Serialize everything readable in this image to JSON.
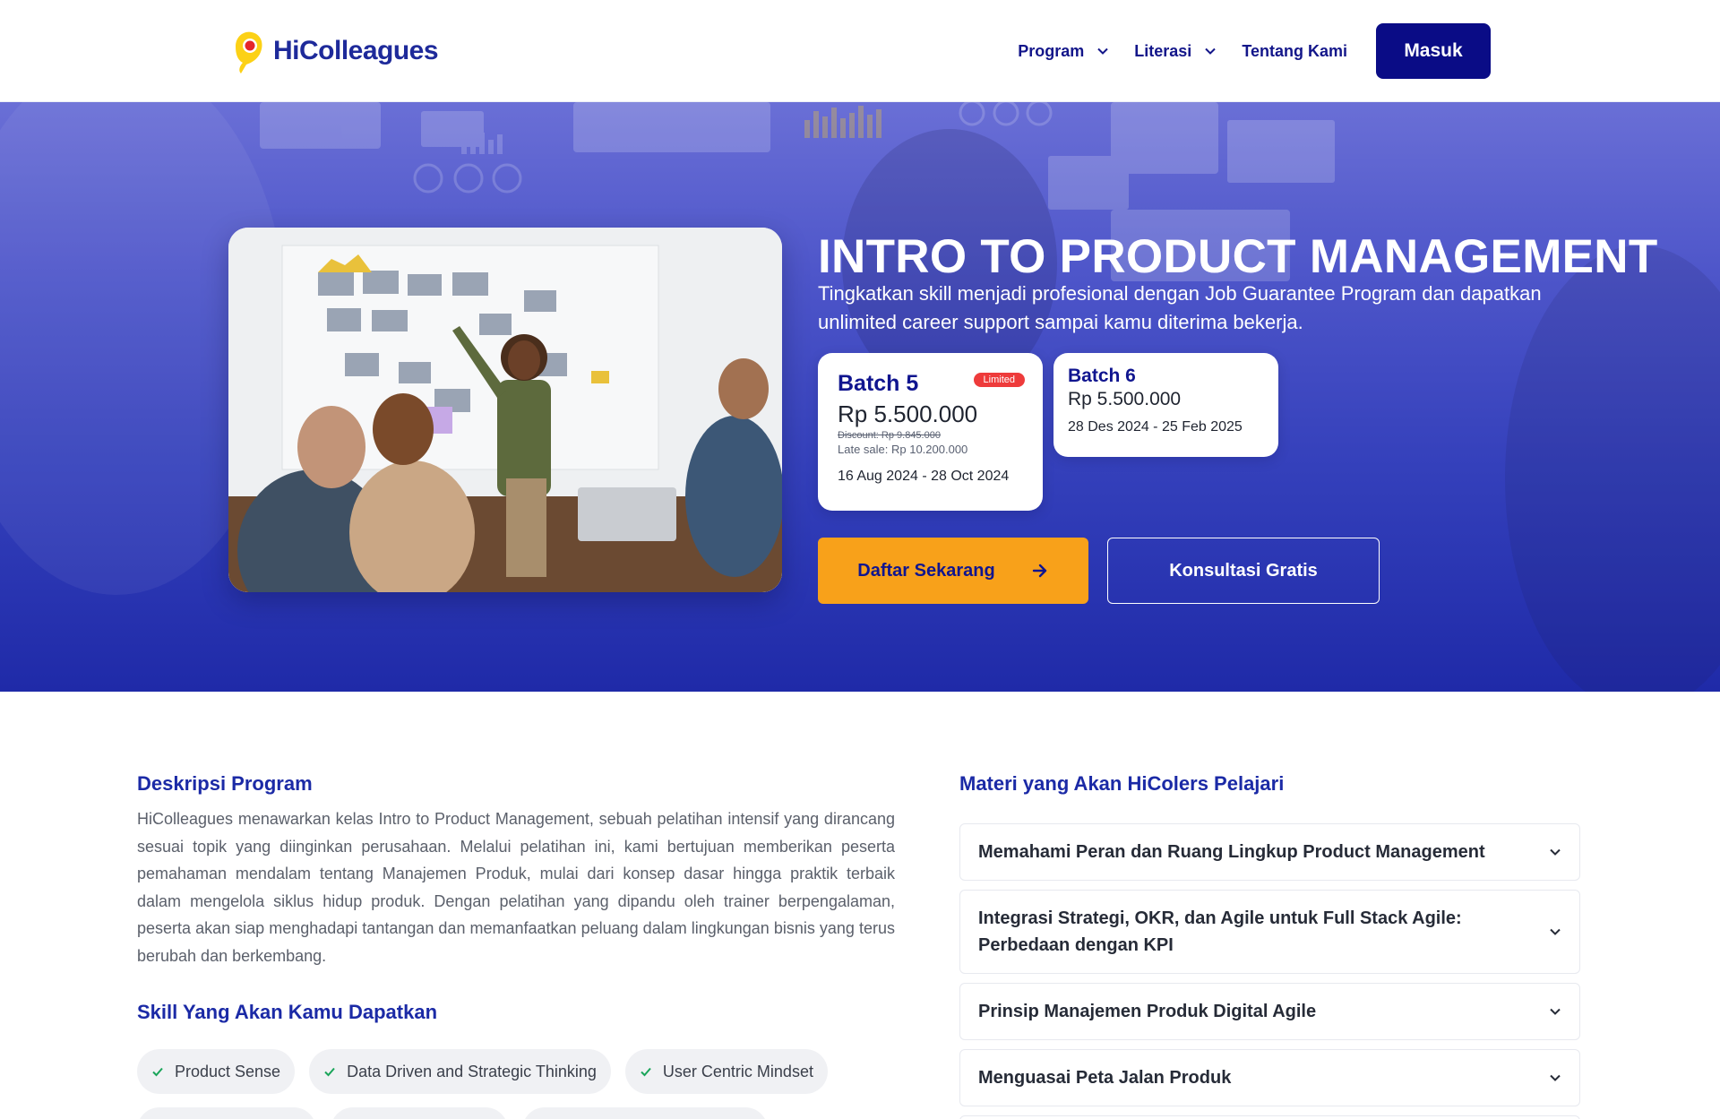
{
  "header": {
    "logo_text": "HiColleagues",
    "nav": [
      {
        "label": "Program",
        "has_dropdown": true
      },
      {
        "label": "Literasi",
        "has_dropdown": true
      },
      {
        "label": "Tentang Kami",
        "has_dropdown": false
      }
    ],
    "login_label": "Masuk"
  },
  "hero": {
    "title": "INTRO TO PRODUCT MANAGEMENT",
    "subtitle": "Tingkatkan skill menjadi profesional dengan Job Guarantee Program dan dapatkan unlimited career support sampai kamu diterima bekerja.",
    "batches": [
      {
        "name": "Batch 5",
        "badge": "Limited",
        "price": "Rp 5.500.000",
        "discount_note": "Discount: Rp 9.845.000",
        "late_sale": "Late sale: Rp 10.200.000",
        "dates": "16 Aug 2024 - 28 Oct 2024"
      },
      {
        "name": "Batch 6",
        "price": "Rp 5.500.000",
        "dates": "28 Des 2024 - 25 Feb 2025"
      }
    ],
    "cta_primary": "Daftar Sekarang",
    "cta_secondary": "Konsultasi Gratis"
  },
  "description": {
    "title": "Deskripsi Program",
    "text": "HiColleagues menawarkan kelas Intro to Product Management, sebuah pelatihan intensif yang dirancang sesuai topik yang diinginkan perusahaan. Melalui pelatihan ini, kami bertujuan memberikan peserta pemahaman mendalam tentang Manajemen Produk, mulai dari konsep dasar hingga praktik terbaik dalam mengelola siklus hidup produk. Dengan pelatihan yang dipandu oleh trainer berpengalaman, peserta akan siap menghadapi tantangan dan memanfaatkan peluang dalam lingkungan bisnis yang terus berubah dan berkembang."
  },
  "skills": {
    "title": "Skill Yang Akan Kamu Dapatkan",
    "items": [
      "Product Sense",
      "Data Driven and Strategic Thinking",
      "User Centric Mindset"
    ]
  },
  "materials": {
    "title": "Materi yang Akan HiColers Pelajari",
    "items": [
      "Memahami Peran dan Ruang Lingkup Product Management",
      "Integrasi Strategi, OKR, dan Agile untuk Full Stack Agile: Perbedaan dengan KPI",
      "Prinsip Manajemen Produk Digital Agile",
      "Menguasai Peta Jalan Produk"
    ]
  },
  "colors": {
    "brand_navy": "#0a0c86",
    "accent_orange": "#f8a11a",
    "badge_red": "#ee3b3b",
    "title_blue": "#1b2aa6"
  }
}
